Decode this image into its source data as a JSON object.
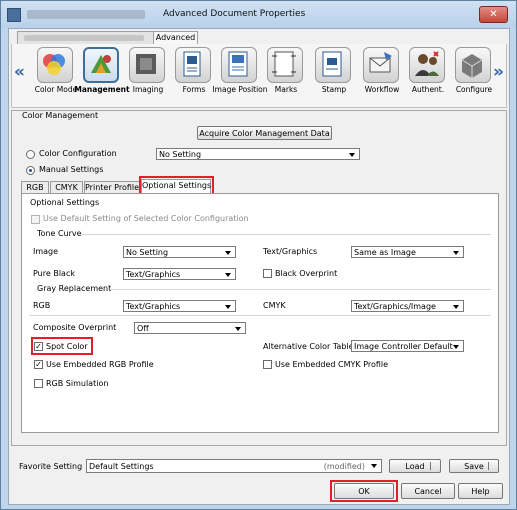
{
  "window": {
    "title": "Advanced Document Properties",
    "close_glyph": "✕"
  },
  "top_tabs": {
    "advanced": "Advanced"
  },
  "nav": {
    "left_arrow": "«",
    "right_arrow": "»",
    "items": [
      {
        "label": "Color Mode",
        "icon": "color-mode-icon"
      },
      {
        "label": "Management",
        "icon": "management-icon"
      },
      {
        "label": "Imaging",
        "icon": "imaging-icon"
      },
      {
        "label": "Forms",
        "icon": "forms-icon"
      },
      {
        "label": "Image Position",
        "icon": "image-position-icon"
      },
      {
        "label": "Marks",
        "icon": "marks-icon"
      },
      {
        "label": "Stamp",
        "icon": "stamp-icon"
      },
      {
        "label": "Workflow",
        "icon": "workflow-icon"
      },
      {
        "label": "Authent.",
        "icon": "authentication-icon"
      },
      {
        "label": "Configure",
        "icon": "configure-icon"
      }
    ]
  },
  "color_management": {
    "heading": "Color Management",
    "acquire_button": "Acquire Color Management Data",
    "color_configuration_label": "Color Configuration",
    "color_configuration_value": "No Setting",
    "manual_settings_label": "Manual Settings"
  },
  "sub_tabs": [
    "RGB",
    "CMYK",
    "Printer Profile",
    "Optional Settings"
  ],
  "optional": {
    "heading": "Optional Settings",
    "use_default": "Use Default Setting of Selected Color Configuration",
    "tone_curve": "Tone Curve",
    "image_label": "Image",
    "image_value": "No Setting",
    "text_graphics_label": "Text/Graphics",
    "text_graphics_value": "Same as Image",
    "pure_black_label": "Pure Black",
    "pure_black_value": "Text/Graphics",
    "black_overprint": "Black Overprint",
    "gray_replacement": "Gray Replacement",
    "rgb_label": "RGB",
    "rgb_value": "Text/Graphics",
    "cmyk_label": "CMYK",
    "cmyk_value": "Text/Graphics/Image",
    "composite_overprint_label": "Composite Overprint",
    "composite_overprint_value": "Off",
    "spot_color": "Spot Color",
    "alt_color_table_label": "Alternative Color Table",
    "alt_color_table_value": "Image Controller Default",
    "use_embedded_rgb": "Use Embedded RGB Profile",
    "use_embedded_cmyk": "Use Embedded CMYK Profile",
    "rgb_simulation": "RGB Simulation",
    "checkmark": "✓"
  },
  "footer": {
    "favorite_label": "Favorite Setting",
    "favorite_value": "Default Settings",
    "modified": "(modified)",
    "load": "Load",
    "save": "Save",
    "ok": "OK",
    "cancel": "Cancel",
    "help": "Help"
  },
  "colors": {
    "highlight": "#e0202a",
    "accent": "#3466a8"
  }
}
